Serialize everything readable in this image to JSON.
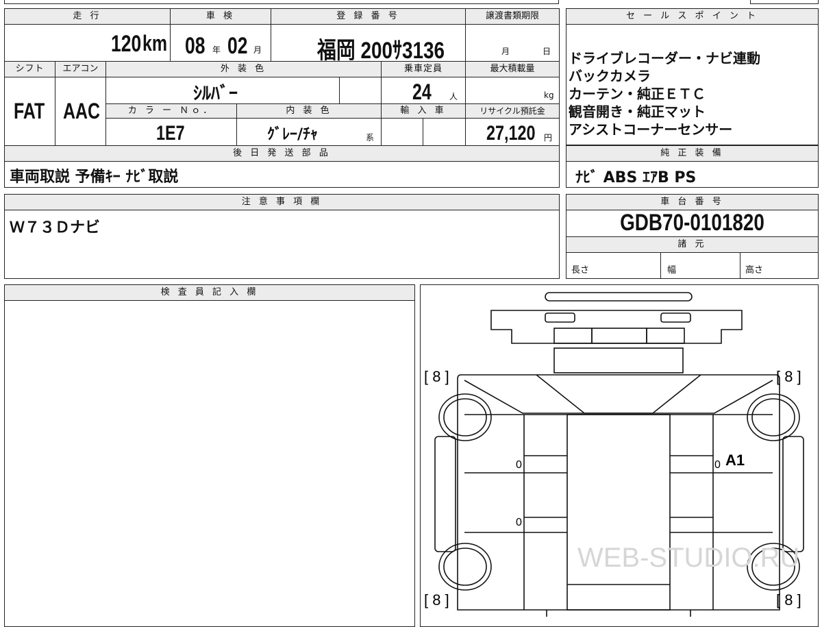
{
  "top_section": {
    "hdr_mileage": "走 行",
    "hdr_inspection": "車 検",
    "hdr_registration": "登 録 番 号",
    "hdr_transfer_deadline": "譲渡書類期限",
    "mileage_value": "120",
    "mileage_unit": "km",
    "inspection_year": "08",
    "year_unit": "年",
    "inspection_month": "02",
    "month_unit": "月",
    "registration_number": "福岡 200ｻ3136",
    "deadline_month_unit": "月",
    "deadline_day_unit": "日",
    "hdr_shift": "シフト",
    "hdr_aircon": "エアコン",
    "hdr_exterior_color": "外 装 色",
    "hdr_capacity": "乗車定員",
    "hdr_max_load": "最大積載量",
    "shift_value": "FAT",
    "aircon_value": "AAC",
    "exterior_color_value": "ｼﾙﾊﾞｰ",
    "capacity_value": "24",
    "capacity_unit": "人",
    "max_load_unit": "kg",
    "hdr_color_no": "カ ラ ー Ｎｏ．",
    "hdr_interior_color": "内 装 色",
    "hdr_import": "輸 入 車",
    "hdr_recycle_fee": "リサイクル預託金",
    "color_no_value": "1E7",
    "interior_color_value": "ｸﾞﾚｰ/ﾁｬ",
    "interior_suffix": "系",
    "recycle_fee_value": "27,120",
    "yen_unit": "円",
    "hdr_later_parts": "後 日 発 送 部 品",
    "later_parts_value": "車両取説 予備ｷｰ ﾅﾋﾞ取説"
  },
  "sales_points": {
    "header": "セ ー ル ス ポ イ ン ト",
    "lines": [
      "ドライブレコーダー・ナビ連動",
      "バックカメラ",
      "カーテン・純正ＥＴＣ",
      "観音開き・純正マット",
      "アシストコーナーセンサー"
    ]
  },
  "genuine_equipment": {
    "header": "純 正 装 備",
    "value": "ﾅﾋﾞ ABS ｴｱB PS"
  },
  "notes": {
    "header": "注 意 事 項 欄",
    "value": "Ｗ７３Ｄナビ"
  },
  "chassis": {
    "header": "車 台 番 号",
    "value": "GDB70-0101820",
    "spec_header": "諸 元",
    "length_label": "長さ",
    "width_label": "幅",
    "height_label": "高さ"
  },
  "inspector": {
    "header": "検 査 員 記 入 欄"
  },
  "diagram": {
    "tire_top_left": "[ 8 ]",
    "tire_top_right": "[ 8 ]",
    "tire_bottom_left": "[ 8 ]",
    "tire_bottom_right": "[ 8 ]",
    "mark_left_upper": "0",
    "mark_left_lower": "0",
    "mark_right": "0",
    "damage_code": "A1",
    "watermark": "WEB-STUDIO.RU"
  }
}
